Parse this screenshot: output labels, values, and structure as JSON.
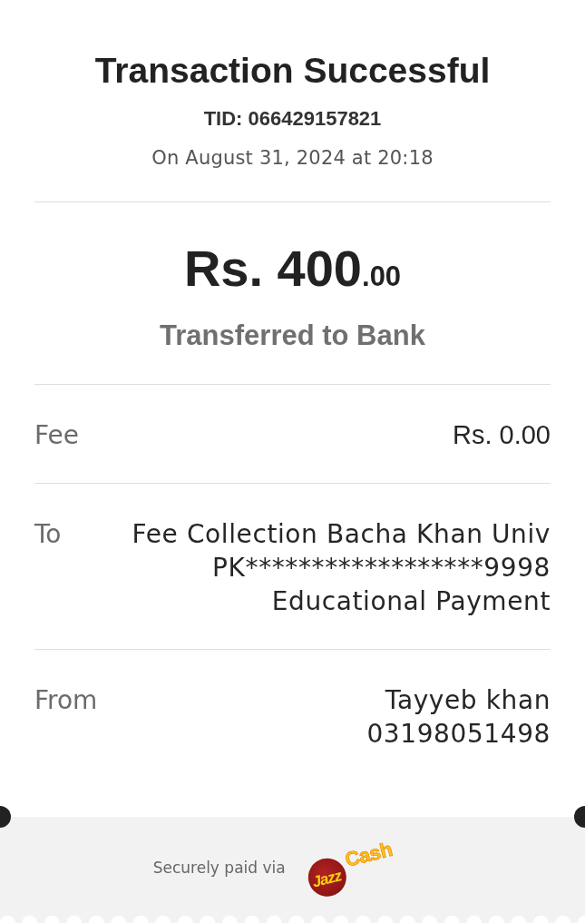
{
  "header": {
    "title": "Transaction Successful",
    "tid": "TID: 066429157821",
    "date": "On August 31, 2024 at 20:18"
  },
  "amount": {
    "main": "Rs. 400",
    "decimals": ".00",
    "description": "Transferred to Bank"
  },
  "details": [
    {
      "kind": "amount",
      "label": "Fee",
      "lines": [
        "Rs. 0.00"
      ]
    },
    {
      "kind": "text",
      "label": "To",
      "lines": [
        "Fee Collection Bacha Khan Univ",
        "PK******************9998",
        "Educational Payment"
      ]
    },
    {
      "kind": "text",
      "label": "From",
      "lines": [
        "Tayyeb khan",
        "03198051498"
      ]
    }
  ],
  "footer": {
    "note": "Securely paid via",
    "logo_words": [
      "Jazz",
      "Cash"
    ]
  }
}
